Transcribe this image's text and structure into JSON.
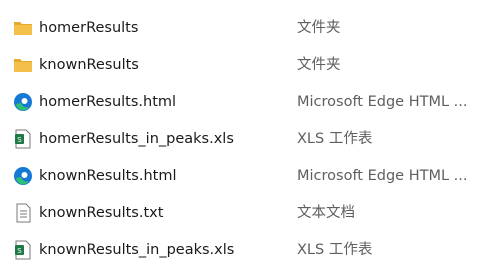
{
  "files": [
    {
      "name": "homerResults",
      "type": "文件夹",
      "icon": "folder-icon"
    },
    {
      "name": "knownResults",
      "type": "文件夹",
      "icon": "folder-icon"
    },
    {
      "name": "homerResults.html",
      "type": "Microsoft Edge HTML ...",
      "icon": "edge-icon"
    },
    {
      "name": "homerResults_in_peaks.xls",
      "type": "XLS 工作表",
      "icon": "spreadsheet-icon"
    },
    {
      "name": "knownResults.html",
      "type": "Microsoft Edge HTML ...",
      "icon": "edge-icon"
    },
    {
      "name": "knownResults.txt",
      "type": "文本文档",
      "icon": "text-file-icon"
    },
    {
      "name": "knownResults_in_peaks.xls",
      "type": "XLS 工作表",
      "icon": "spreadsheet-icon"
    }
  ],
  "colors": {
    "folder": "#f4c04a",
    "folder_tab": "#e6a92b",
    "edge_blue": "#1578d4",
    "edge_green": "#2fbf71",
    "spreadsheet": "#1d7a44",
    "name_text": "#1a1a1a",
    "type_text": "#5f5f5f"
  }
}
